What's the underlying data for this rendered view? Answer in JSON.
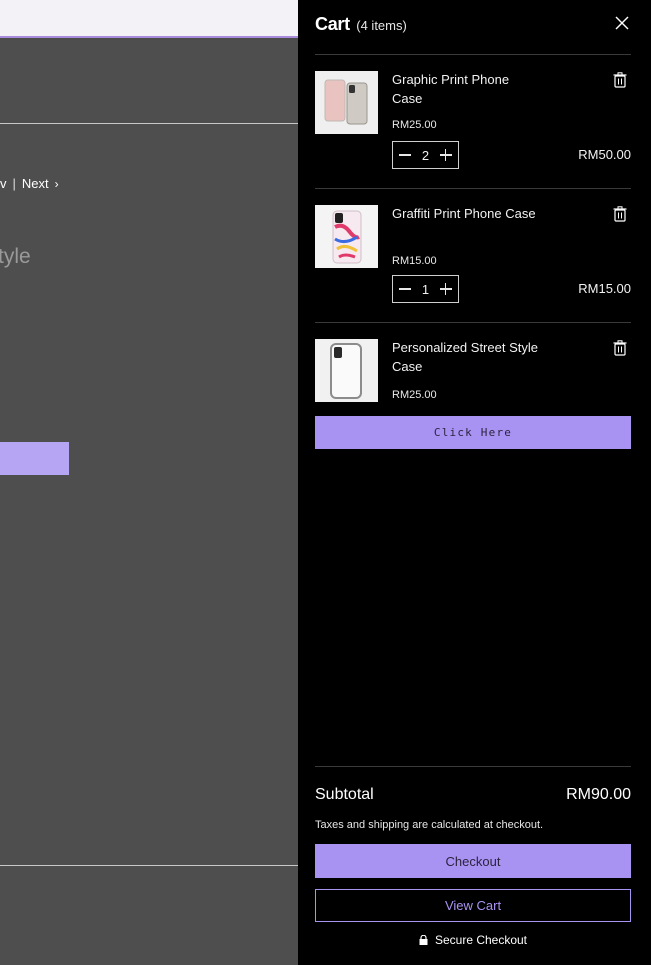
{
  "background_page": {
    "nav_prev_fragment": "v",
    "nav_next_label": "Next",
    "title_fragment": "tyle"
  },
  "cart": {
    "title": "Cart",
    "count_label": "(4 items)",
    "items": [
      {
        "name": "Graphic Print Phone Case",
        "price": "RM25.00",
        "quantity": "2",
        "line_total": "RM50.00"
      },
      {
        "name": "Graffiti Print Phone Case",
        "price": "RM15.00",
        "quantity": "1",
        "line_total": "RM15.00"
      },
      {
        "name": "Personalized Street Style Case",
        "price": "RM25.00",
        "quantity": "",
        "line_total": ""
      }
    ],
    "click_here_label": "Click Here",
    "subtotal_label": "Subtotal",
    "subtotal_value": "RM90.00",
    "tax_note": "Taxes and shipping are calculated at checkout.",
    "checkout_label": "Checkout",
    "view_cart_label": "View Cart",
    "secure_label": "Secure Checkout"
  },
  "colors": {
    "accent": "#a993f2",
    "drawer_bg": "#000000",
    "overlay_bg": "#4e4e4e"
  }
}
